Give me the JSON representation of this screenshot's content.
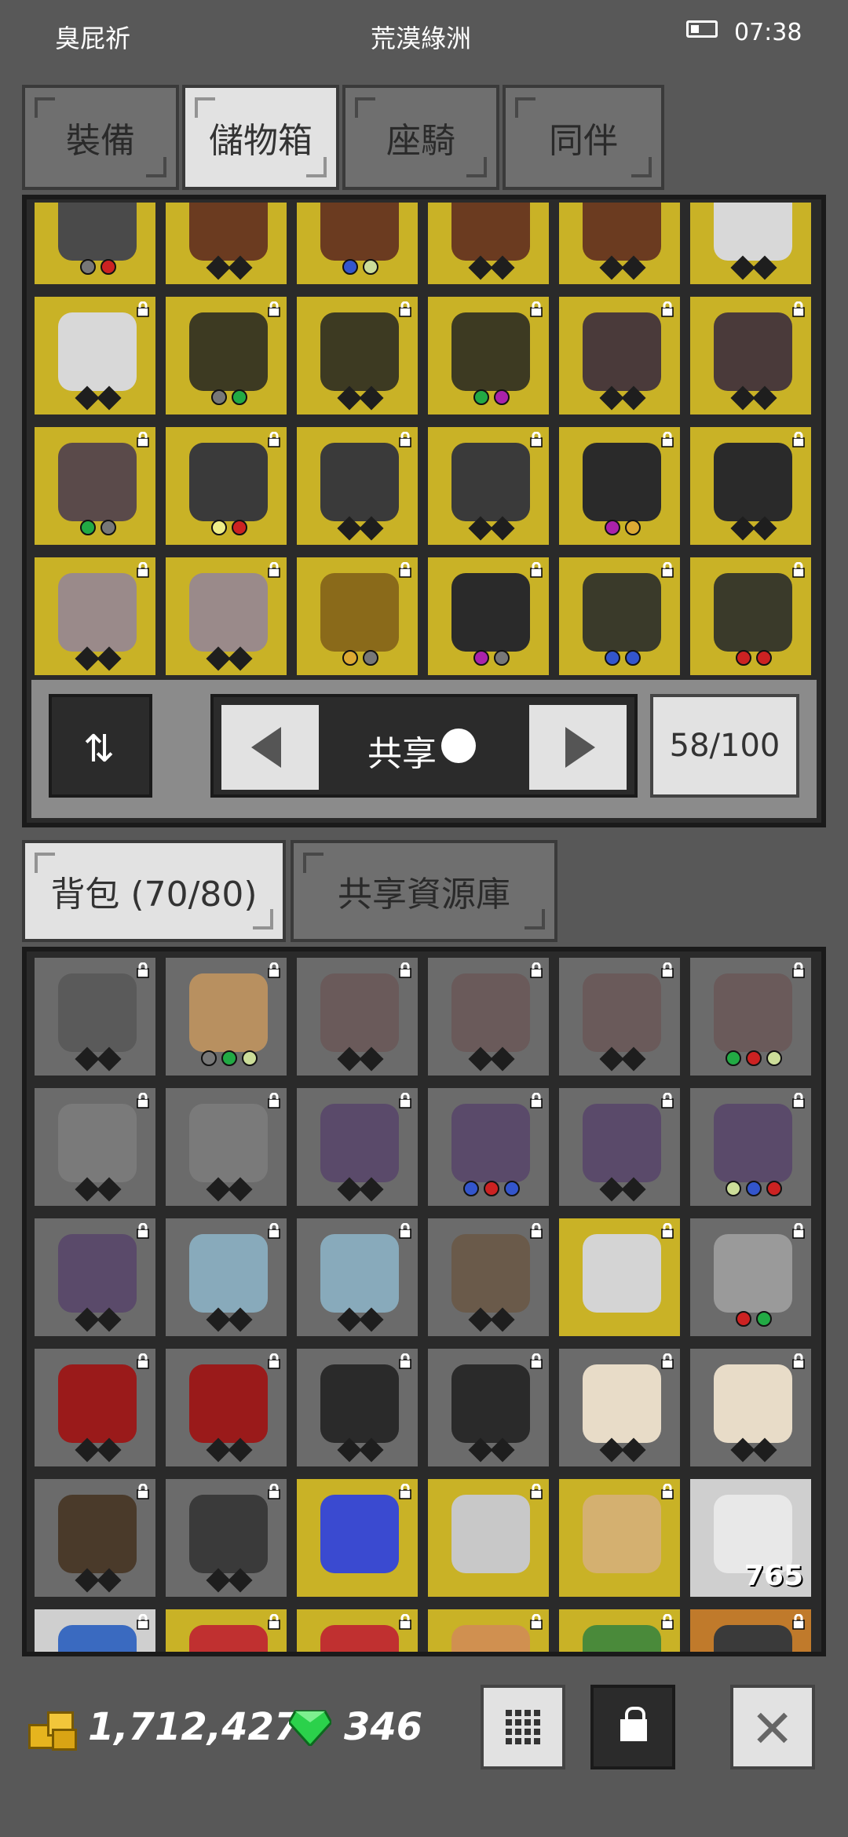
{
  "status": {
    "left_text": "臭屁祈",
    "center_text": "荒漠綠洲",
    "time": "07:38"
  },
  "top_tabs": [
    {
      "label": "裝備",
      "active": false
    },
    {
      "label": "儲物箱",
      "active": true
    },
    {
      "label": "座騎",
      "active": false
    },
    {
      "label": "同伴",
      "active": false
    }
  ],
  "storage": {
    "sort_icon": "sort-icon",
    "shared_label": "共享",
    "capacity": "58/100"
  },
  "bottom_tabs": [
    {
      "label": "背包 (70/80)",
      "active": true
    },
    {
      "label": "共享資源庫",
      "active": false
    }
  ],
  "inventory": {
    "potion_count": "765"
  },
  "footer": {
    "gold": "1,712,427",
    "gems": "346"
  },
  "colors": {
    "background": "#585858",
    "highlight_cell": "#c9b226",
    "panel": "#2a2a2a"
  }
}
